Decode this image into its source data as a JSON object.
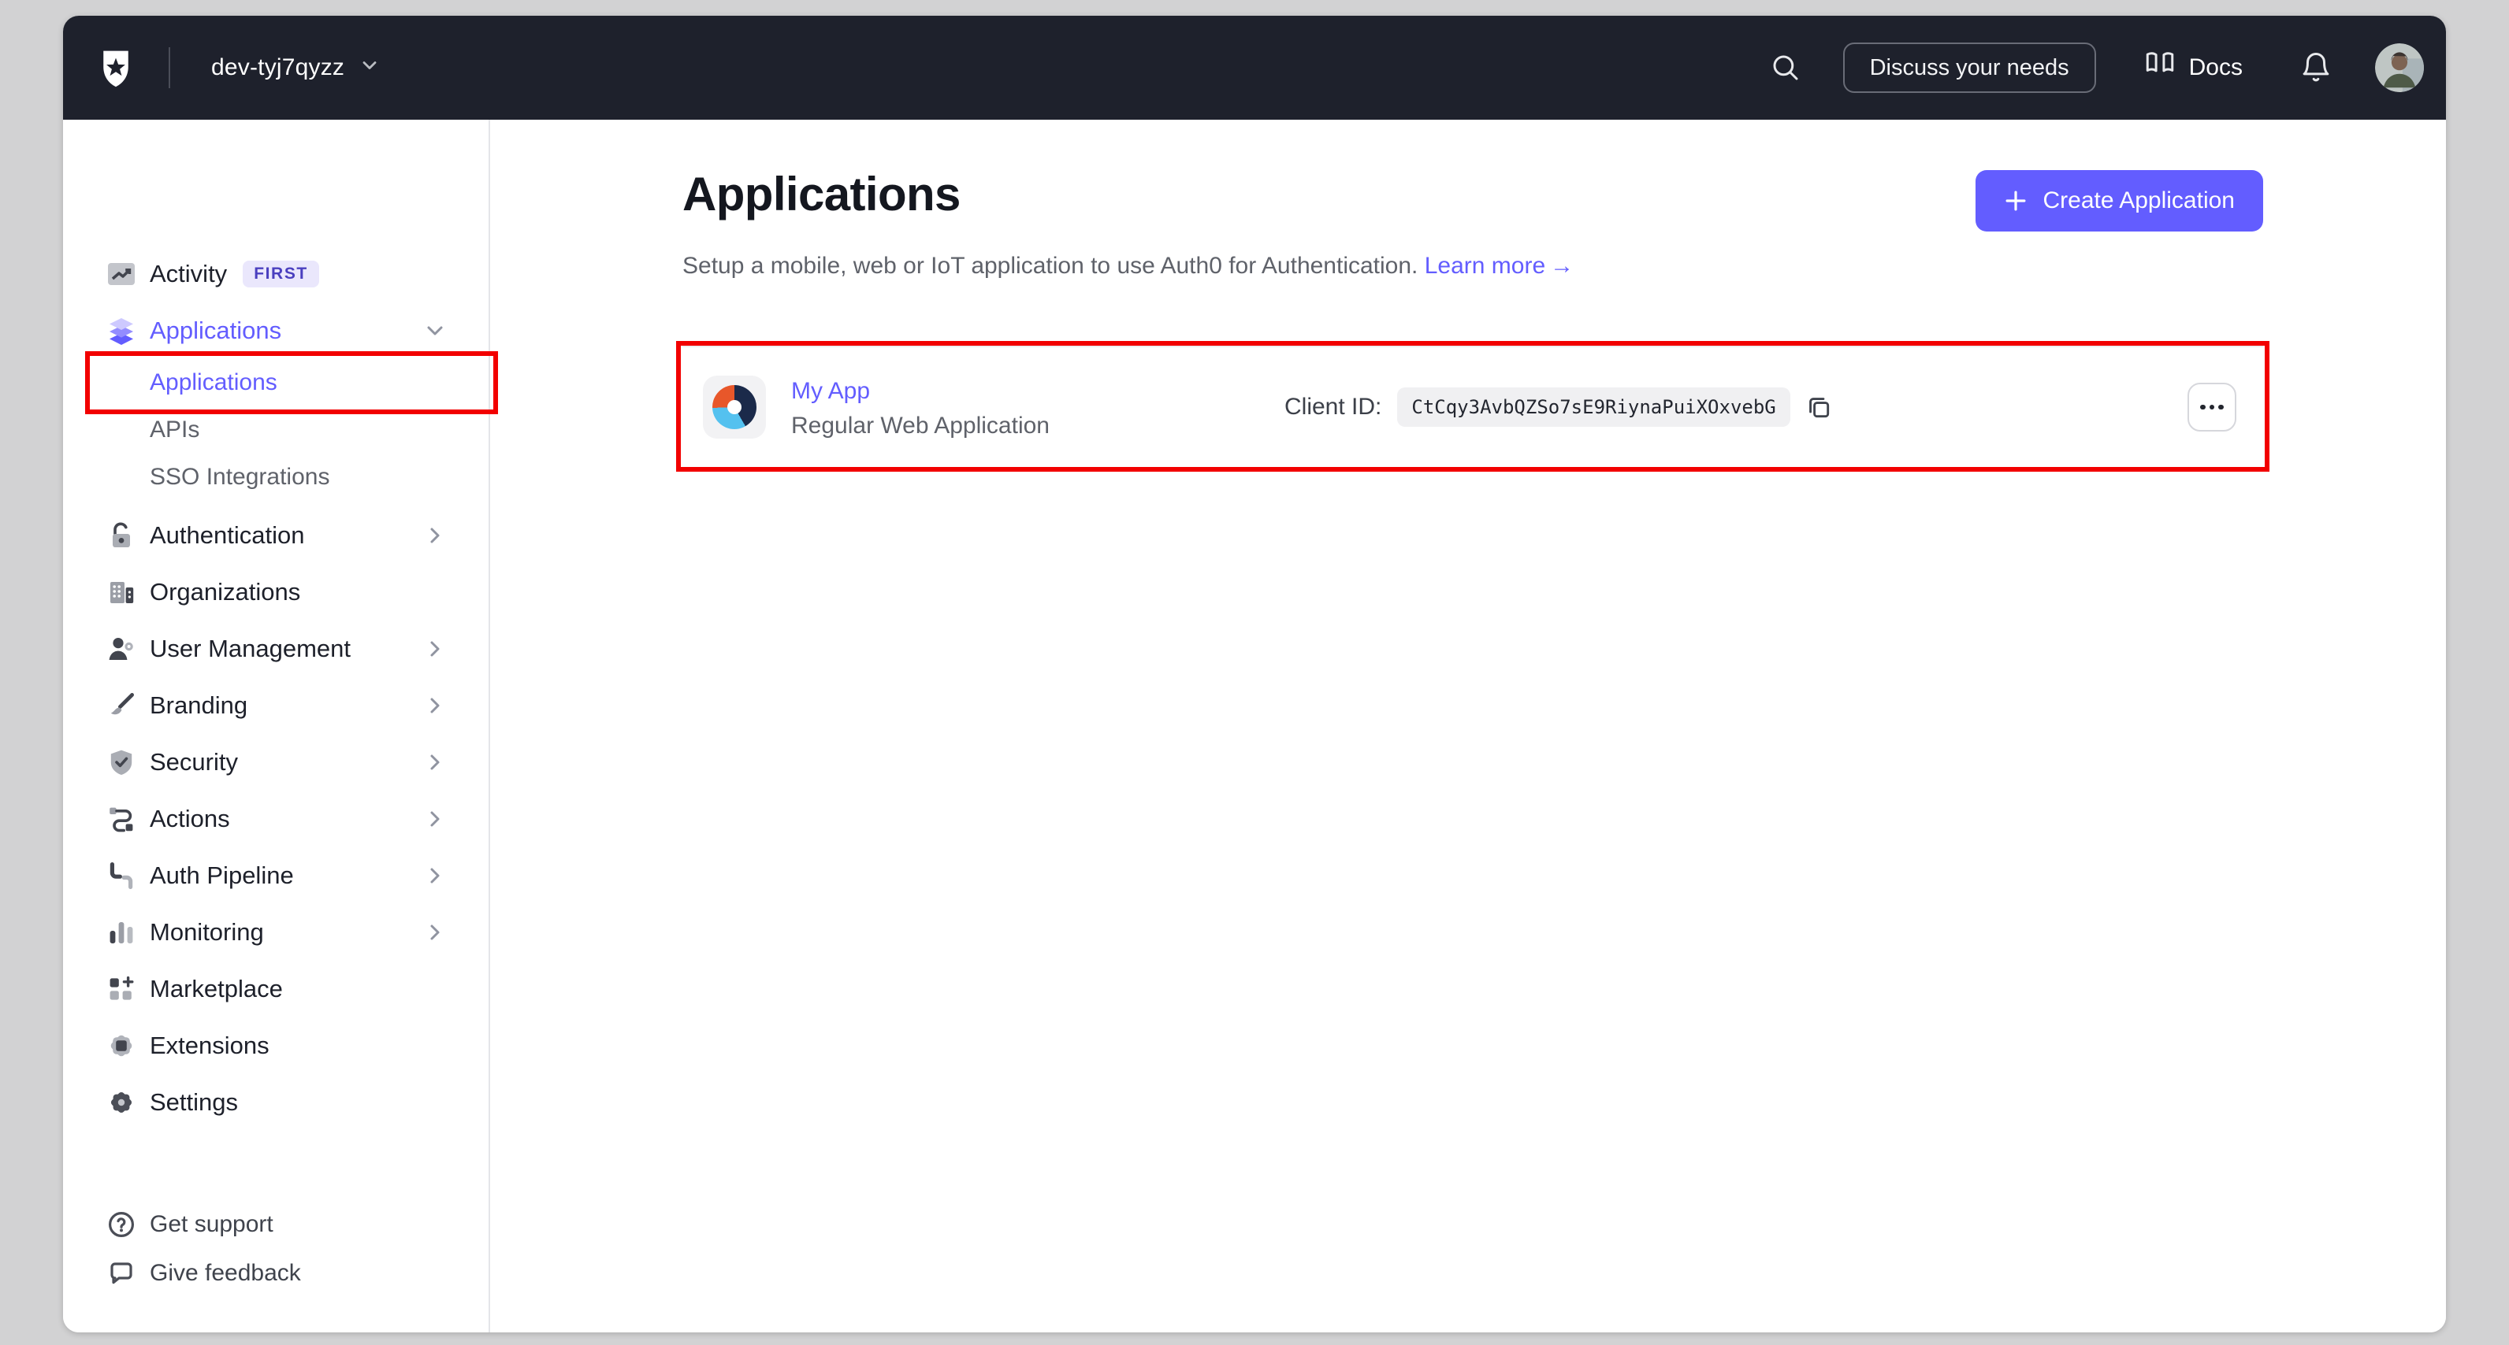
{
  "colors": {
    "accent": "#635dff",
    "annotation": "#f20000",
    "navbar_bg": "#1e212c",
    "page_bg": "#d2d2d3",
    "app_logo_orange": "#e8572a",
    "app_logo_navy": "#1b2a4a",
    "app_logo_blue": "#54c1ef"
  },
  "navbar": {
    "tenant": "dev-tyj7qyzz",
    "discuss_label": "Discuss your needs",
    "docs_label": "Docs",
    "icons": [
      "auth0-logo",
      "chevron-down",
      "search",
      "book-open",
      "bell",
      "avatar"
    ]
  },
  "sidebar": {
    "items": [
      {
        "label": "Activity",
        "badge": "FIRST"
      },
      {
        "label": "Applications",
        "active": true,
        "expanded": true
      },
      {
        "label": "Applications",
        "active": true,
        "annotated": true
      },
      {
        "label": "APIs"
      },
      {
        "label": "SSO Integrations"
      },
      {
        "label": "Authentication",
        "has_submenu": true
      },
      {
        "label": "Organizations"
      },
      {
        "label": "User Management",
        "has_submenu": true
      },
      {
        "label": "Branding",
        "has_submenu": true
      },
      {
        "label": "Security",
        "has_submenu": true
      },
      {
        "label": "Actions",
        "has_submenu": true
      },
      {
        "label": "Auth Pipeline",
        "has_submenu": true
      },
      {
        "label": "Monitoring",
        "has_submenu": true
      },
      {
        "label": "Marketplace"
      },
      {
        "label": "Extensions"
      },
      {
        "label": "Settings"
      }
    ],
    "footer_items": [
      {
        "label": "Get support"
      },
      {
        "label": "Give feedback"
      }
    ]
  },
  "main": {
    "title": "Applications",
    "subtitle": "Setup a mobile, web or IoT application to use Auth0 for Authentication.",
    "learn_more_label": "Learn more",
    "learn_more_arrow": "→",
    "create_button_label": "Create Application",
    "app": {
      "name": "My App",
      "type": "Regular Web Application",
      "client_id_label": "Client ID:",
      "client_id": "CtCqy3AvbQZSo7sE9RiynaPuiXOxvebG"
    }
  }
}
